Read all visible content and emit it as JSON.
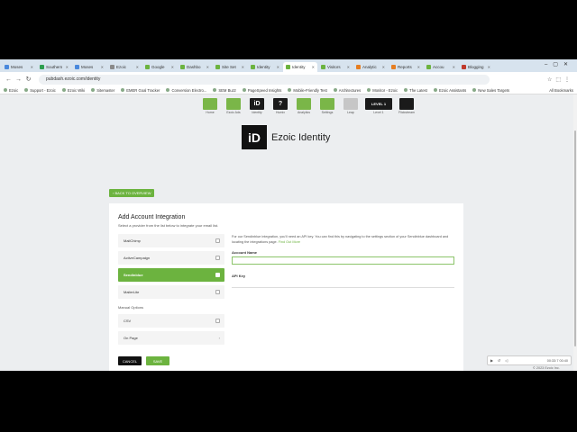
{
  "tabs": [
    {
      "title": "Moses",
      "color": "#4a89dc",
      "active": false
    },
    {
      "title": "Southern",
      "color": "#2e9e4f",
      "active": false
    },
    {
      "title": "Moses",
      "color": "#4a89dc",
      "active": false
    },
    {
      "title": "Ezoic",
      "color": "#8a8a8a",
      "active": false
    },
    {
      "title": "Google",
      "color": "#6cb33f",
      "active": false
    },
    {
      "title": "Dashbo",
      "color": "#6cb33f",
      "active": false
    },
    {
      "title": "Site Set",
      "color": "#6cb33f",
      "active": false
    },
    {
      "title": "Identity",
      "color": "#6cb33f",
      "active": false
    },
    {
      "title": "Identity",
      "color": "#6cb33f",
      "active": true
    },
    {
      "title": "Visitors",
      "color": "#6cb33f",
      "active": false
    },
    {
      "title": "Analytic",
      "color": "#e67e22",
      "active": false
    },
    {
      "title": "Reports",
      "color": "#e67e22",
      "active": false
    },
    {
      "title": "Accou",
      "color": "#6cb33f",
      "active": false
    },
    {
      "title": "Blogging",
      "color": "#c0392b",
      "active": false
    }
  ],
  "address": {
    "url": "pubdash.ezoic.com/identity"
  },
  "bookmarks": [
    "Ezoic",
    "Support - Ezoic",
    "Ezoic Wiki",
    "Sitemaster",
    "EMER Goal Tracker",
    "Conversion Electro...",
    "SEM Buzz",
    "PageSpeed Insights",
    "Mobile-Friendly Test",
    "Architectures",
    "Monitor - Ezoic",
    "The Latest",
    "Ezoic Assistants",
    "New Sales Targets"
  ],
  "bookmarks_all": "All Bookmarks",
  "apps": [
    {
      "label": "Home",
      "icon": "",
      "style": "green"
    },
    {
      "label": "Ezoic Ads",
      "icon": "",
      "style": "green"
    },
    {
      "label": "Identity",
      "icon": "iD",
      "style": "dark"
    },
    {
      "label": "Humix",
      "icon": "?",
      "style": "dark"
    },
    {
      "label": "Analytics",
      "icon": "",
      "style": "green"
    },
    {
      "label": "Settings",
      "icon": "",
      "style": "green"
    },
    {
      "label": "Leap",
      "icon": "",
      "style": "grey"
    },
    {
      "label": "Level 1",
      "icon": "LEVEL 1",
      "style": "dark-wide"
    },
    {
      "label": "Flickstream",
      "icon": "",
      "style": "dark"
    }
  ],
  "brand": {
    "logo_text": "iD",
    "name": "Ezoic Identity"
  },
  "back_button": "BACK TO OVERVIEW",
  "card": {
    "title": "Add Account Integration",
    "subtitle": "Select a provider from the list below to integrate your email list.",
    "providers": [
      {
        "label": "MailChimp",
        "selected": false
      },
      {
        "label": "ActiveCampaign",
        "selected": false
      },
      {
        "label": "Sendinblue",
        "selected": true
      },
      {
        "label": "MailerLite",
        "selected": false
      }
    ],
    "manual_label": "Manual Options",
    "manual": [
      {
        "label": "CSV",
        "kind": "check"
      },
      {
        "label": "On Page",
        "kind": "arrow"
      }
    ],
    "description": "For our Sendinblue integration, you'll need an API key. You can find this by navigating to the settings section of your Sendinblue dashboard and locating the integrations page.",
    "find_out_more": "Find Out More",
    "account_name_label": "Account Name",
    "account_name_value": "",
    "api_key_label": "API Key",
    "api_key_value": "",
    "cancel": "CANCEL",
    "save": "SAVE"
  },
  "video_bar": {
    "time": "00:33:7  00:40"
  },
  "copyright": "© 2023 Ezoic Inc."
}
